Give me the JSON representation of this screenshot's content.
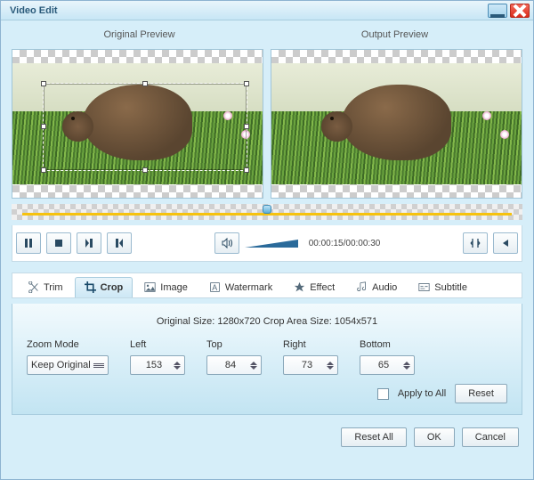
{
  "title": "Video Edit",
  "previews": {
    "original": "Original Preview",
    "output": "Output Preview"
  },
  "playback": {
    "time": "00:00:15/00:00:30"
  },
  "tabs": {
    "trim": "Trim",
    "crop": "Crop",
    "image": "Image",
    "watermark": "Watermark",
    "effect": "Effect",
    "audio": "Audio",
    "subtitle": "Subtitle"
  },
  "crop": {
    "sizeinfo": "Original Size: 1280x720  Crop Area Size: 1054x571",
    "zoom_label": "Zoom Mode",
    "zoom_value": "Keep Original",
    "left_label": "Left",
    "left_value": "153",
    "top_label": "Top",
    "top_value": "84",
    "right_label": "Right",
    "right_value": "73",
    "bottom_label": "Bottom",
    "bottom_value": "65",
    "apply_all": "Apply to All",
    "reset": "Reset"
  },
  "footer": {
    "reset_all": "Reset All",
    "ok": "OK",
    "cancel": "Cancel"
  }
}
